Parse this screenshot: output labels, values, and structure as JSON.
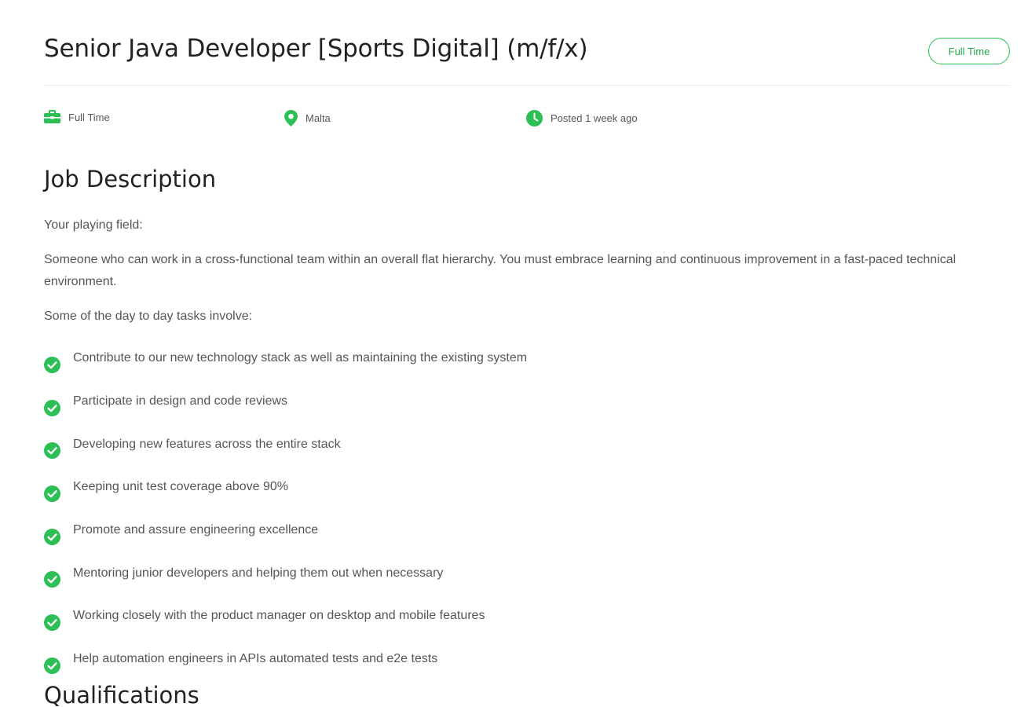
{
  "job": {
    "title": "Senior Java Developer [Sports Digital] (m/f/x)",
    "type_badge": "Full Time"
  },
  "meta": {
    "employment_type": "Full Time",
    "location": "Malta",
    "posted": "Posted 1 week ago"
  },
  "description": {
    "heading": "Job Description",
    "intro": "Your playing field:",
    "summary": "Someone who can work in a cross-functional team within an overall flat hierarchy. You must embrace learning and continuous improvement in a fast-paced technical environment.",
    "tasks_intro": "Some of the day to day tasks involve:",
    "tasks": [
      "Contribute to our new technology stack as well as maintaining the existing system",
      "Participate in design and code reviews",
      "Developing new features across the entire stack",
      "Keeping unit test coverage above 90%",
      "Promote and assure engineering excellence",
      "Mentoring junior developers and helping them out when necessary",
      "Working closely with the product manager on desktop and mobile features",
      "Help automation engineers in APIs automated tests and e2e tests"
    ]
  },
  "qualifications": {
    "heading": "Qualifications"
  },
  "icons": {
    "employment_type": "briefcase-icon",
    "location": "map-pin-icon",
    "posted": "clock-icon",
    "task": "check-circle-icon"
  },
  "colors": {
    "accent": "#2bbf55",
    "heading": "#222222",
    "text": "#555555"
  }
}
